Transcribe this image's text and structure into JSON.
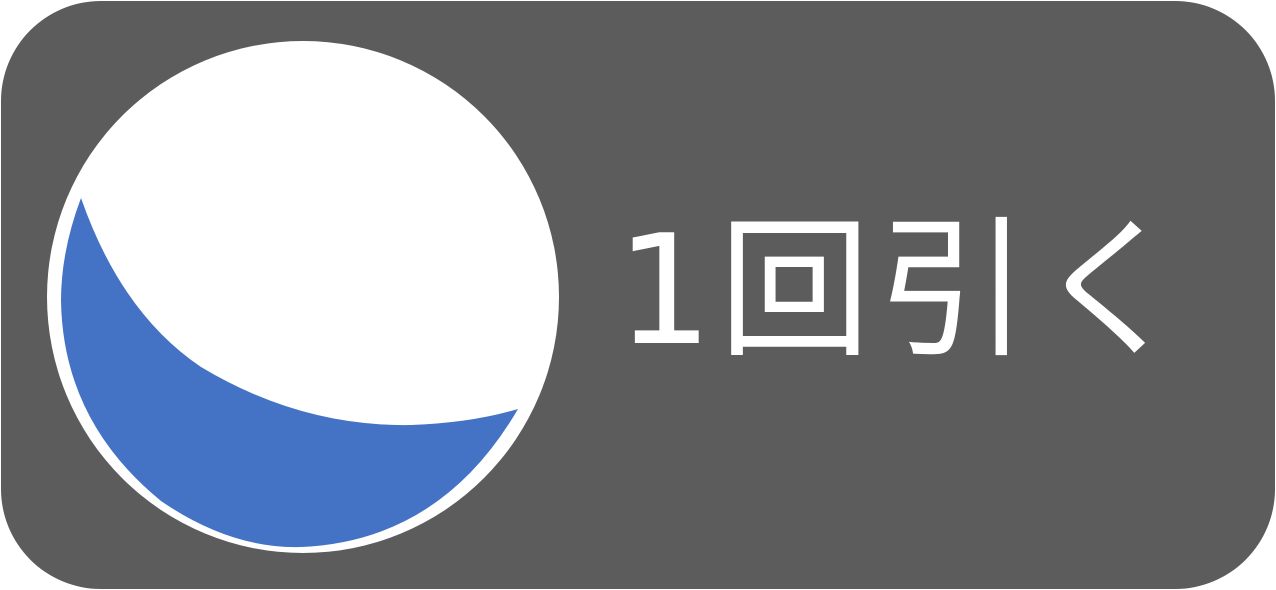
{
  "badge": {
    "label": "1回引く",
    "colors": {
      "background": "#5c5c5c",
      "ball_fill": "#4472c4",
      "ball_highlight": "#ffffff",
      "text": "#ffffff"
    },
    "icon": "ball-icon"
  }
}
